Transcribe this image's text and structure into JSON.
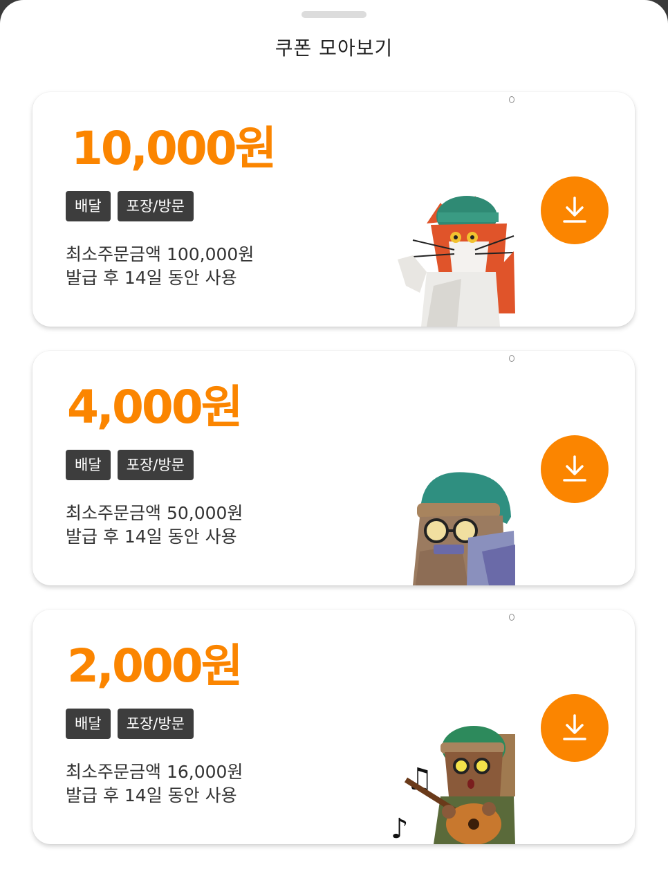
{
  "sheet": {
    "title": "쿠폰 모아보기"
  },
  "coupons": [
    {
      "amount": "10,000원",
      "tags": [
        "배달",
        "포장/방문"
      ],
      "min_order": "최소주문금액 100,000원",
      "validity": "발급 후 14일 동안 사용",
      "illustration": "cat-character-icon"
    },
    {
      "amount": "4,000원",
      "tags": [
        "배달",
        "포장/방문"
      ],
      "min_order": "최소주문금액 50,000원",
      "validity": "발급 후 14일 동안 사용",
      "illustration": "harmonica-character-icon"
    },
    {
      "amount": "2,000원",
      "tags": [
        "배달",
        "포장/방문"
      ],
      "min_order": "최소주문금액 16,000원",
      "validity": "발급 후 14일 동안 사용",
      "illustration": "guitar-character-icon"
    }
  ],
  "icons": {
    "download": "download-icon"
  },
  "colors": {
    "accent": "#fb8500",
    "tag_bg": "#3d3d3d",
    "text": "#333333"
  }
}
